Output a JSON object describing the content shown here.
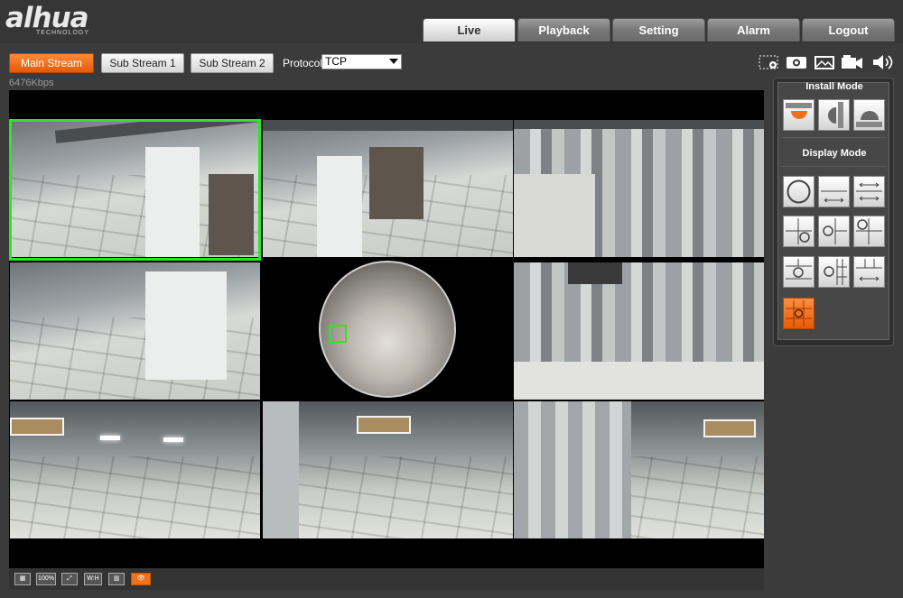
{
  "header": {
    "logo_text": "alhua",
    "logo_subtext": "TECHNOLOGY",
    "tabs": [
      {
        "label": "Live",
        "active": true
      },
      {
        "label": "Playback",
        "active": false
      },
      {
        "label": "Setting",
        "active": false
      },
      {
        "label": "Alarm",
        "active": false
      },
      {
        "label": "Logout",
        "active": false
      }
    ]
  },
  "toolbar": {
    "streams": [
      {
        "label": "Main Stream",
        "active": true
      },
      {
        "label": "Sub Stream 1",
        "active": false
      },
      {
        "label": "Sub Stream 2",
        "active": false
      }
    ],
    "protocol_label": "Protocol",
    "protocol_value": "TCP",
    "icons": [
      "zoom-region-icon",
      "snapshot-icon",
      "triple-snapshot-icon",
      "record-icon",
      "audio-icon"
    ]
  },
  "video": {
    "bitrate": "6476Kbps",
    "layout": "3x3 fisheye dewarp",
    "selected_view": 1
  },
  "bottom_bar": {
    "zoom_label": "100%",
    "ratio_label": "W:H",
    "icons": [
      "fit-window-icon",
      "original-size-icon",
      "fullscreen-icon",
      "aspect-ratio-icon",
      "smart-codec-icon",
      "eye-icon"
    ]
  },
  "side_panel": {
    "install_mode_title": "Install Mode",
    "display_mode_title": "Display Mode",
    "install_modes": [
      "ceiling-mount-icon",
      "wall-mount-icon",
      "ground-mount-icon"
    ],
    "display_modes": [
      "fisheye-original-icon",
      "panorama-180-icon",
      "panorama-360-icon",
      "1p1-icon",
      "1p2-icon",
      "1p3-icon",
      "1p4-icon",
      "2p-icon",
      "1p6-icon",
      "1p8-icon"
    ],
    "active_display_mode": "1p8-icon",
    "accent_color": "#f07020"
  }
}
